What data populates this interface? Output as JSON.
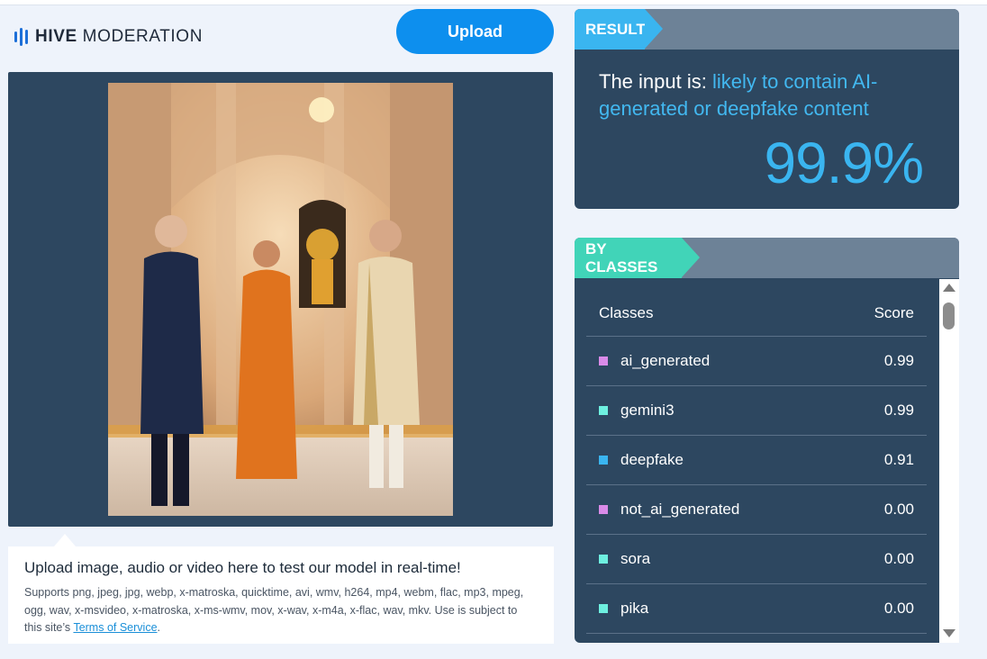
{
  "brand": {
    "name_bold": "HIVE",
    "name_rest": "MODERATION",
    "icon": "hive-bars-icon",
    "color": "#1d6fd8"
  },
  "upload_button": {
    "label": "Upload",
    "color": "#0d8fee"
  },
  "upload_info": {
    "title": "Upload image, audio or video here to test our model in real-time!",
    "supports_text": "Supports png, jpeg, jpg, webp, x-matroska, quicktime, avi, wmv, h264, mp4, webm, flac, mp3, mpeg, ogg, wav, x-msvideo, x-matroska, x-ms-wmv, mov, x-wav, x-m4a, x-flac, wav, mkv. Use is subject to this site’s ",
    "tos_link": "Terms of Service",
    "suffix": "."
  },
  "result": {
    "tag": "RESULT",
    "prefix": "The input is: ",
    "verdict": "likely to contain AI-generated or deepfake content",
    "score": "99.9%",
    "accent": "#3ab5f0"
  },
  "by_classes": {
    "tag": "BY CLASSES",
    "accent": "#41d4b8",
    "col_class": "Classes",
    "col_score": "Score",
    "rows": [
      {
        "name": "ai_generated",
        "score": "0.99",
        "color": "#d98be8"
      },
      {
        "name": "gemini3",
        "score": "0.99",
        "color": "#6ef0e0"
      },
      {
        "name": "deepfake",
        "score": "0.91",
        "color": "#3ab5f0"
      },
      {
        "name": "not_ai_generated",
        "score": "0.00",
        "color": "#d98be8"
      },
      {
        "name": "sora",
        "score": "0.00",
        "color": "#6ef0e0"
      },
      {
        "name": "pika",
        "score": "0.00",
        "color": "#6ef0e0"
      }
    ]
  }
}
